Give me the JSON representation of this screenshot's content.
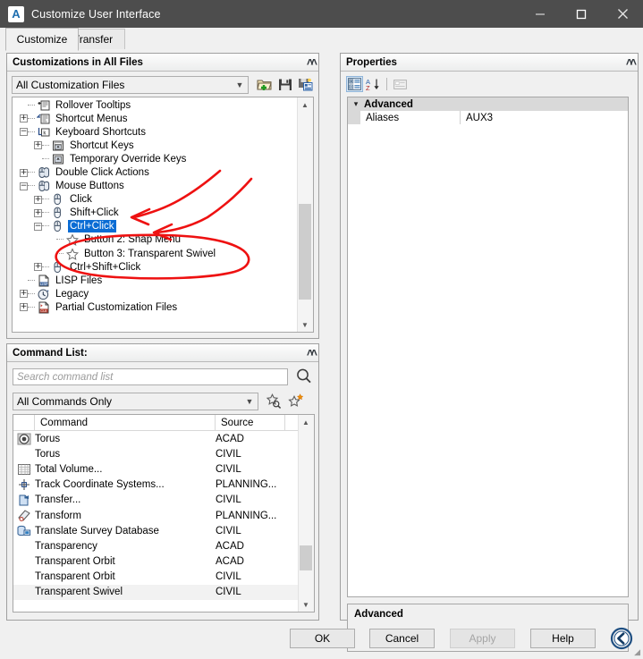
{
  "window": {
    "title": "Customize User Interface",
    "app_icon": "autocad-a-icon",
    "minimize": "minimize-icon",
    "maximize": "maximize-icon",
    "close": "close-icon"
  },
  "tabs": [
    {
      "label": "Customize",
      "active": true
    },
    {
      "label": "Transfer",
      "active": false
    }
  ],
  "customizations_panel": {
    "title": "Customizations in All Files",
    "collapse_icon": "chevron-up-icon",
    "file_filter": {
      "value": "All Customization Files",
      "arrow": "chevron-down-icon"
    },
    "toolbar": [
      {
        "name": "load-partial-customization-file-icon"
      },
      {
        "name": "save-customization-file-icon"
      },
      {
        "name": "save-all-customization-files-icon"
      }
    ],
    "tree": [
      {
        "label": "Rollover Tooltips",
        "indent": 1,
        "expander": "none",
        "icon": "rollover-tooltip-icon",
        "selected": false
      },
      {
        "label": "Shortcut Menus",
        "indent": 1,
        "expander": "plus",
        "icon": "shortcut-menu-icon",
        "selected": false
      },
      {
        "label": "Keyboard Shortcuts",
        "indent": 1,
        "expander": "minus",
        "icon": "keyboard-shortcut-icon",
        "selected": false
      },
      {
        "label": "Shortcut Keys",
        "indent": 2,
        "expander": "plus",
        "icon": "shortcut-key-icon",
        "selected": false
      },
      {
        "label": "Temporary Override Keys",
        "indent": 2,
        "expander": "none",
        "icon": "override-key-icon",
        "selected": false
      },
      {
        "label": "Double Click Actions",
        "indent": 1,
        "expander": "plus",
        "icon": "double-click-mouse-icon",
        "selected": false
      },
      {
        "label": "Mouse Buttons",
        "indent": 1,
        "expander": "minus",
        "icon": "mouse-buttons-icon",
        "selected": false
      },
      {
        "label": "Click",
        "indent": 2,
        "expander": "plus",
        "icon": "mouse-icon",
        "selected": false
      },
      {
        "label": "Shift+Click",
        "indent": 2,
        "expander": "plus",
        "icon": "mouse-icon",
        "selected": false
      },
      {
        "label": "Ctrl+Click",
        "indent": 2,
        "expander": "minus",
        "icon": "mouse-icon",
        "selected": true
      },
      {
        "label": "Button 2: Snap Menu",
        "indent": 3,
        "expander": "none",
        "icon": "star-command-icon",
        "selected": false
      },
      {
        "label": "Button 3: Transparent Swivel",
        "indent": 3,
        "expander": "none",
        "icon": "star-command-icon",
        "selected": false
      },
      {
        "label": "Ctrl+Shift+Click",
        "indent": 2,
        "expander": "plus",
        "icon": "mouse-icon",
        "selected": false
      },
      {
        "label": "LISP Files",
        "indent": 1,
        "expander": "none",
        "icon": "lisp-file-icon",
        "selected": false
      },
      {
        "label": "Legacy",
        "indent": 1,
        "expander": "plus",
        "icon": "legacy-clock-icon",
        "selected": false
      },
      {
        "label": "Partial Customization Files",
        "indent": 1,
        "expander": "plus",
        "icon": "cui-file-icon",
        "selected": false
      }
    ],
    "scroll": {
      "up_arrow": "chevron-up-icon",
      "down_arrow": "chevron-down-icon"
    }
  },
  "command_list_panel": {
    "title": "Command List:",
    "collapse_icon": "chevron-up-icon",
    "search": {
      "placeholder": "Search command list",
      "value": "",
      "icon": "search-icon"
    },
    "category_filter": {
      "value": "All Commands Only",
      "arrow": "chevron-down-icon"
    },
    "toolbar": [
      {
        "name": "find-command-icon"
      },
      {
        "name": "new-command-icon"
      }
    ],
    "columns": [
      "",
      "Command",
      "Source"
    ],
    "rows": [
      {
        "icon": "torus-icon",
        "command": "Torus",
        "source": "ACAD",
        "highlighted": false
      },
      {
        "icon": "none",
        "command": "Torus",
        "source": "CIVIL",
        "highlighted": false
      },
      {
        "icon": "total-volume-icon",
        "command": "Total Volume...",
        "source": "CIVIL",
        "highlighted": false
      },
      {
        "icon": "track-coordinate-icon",
        "command": "Track Coordinate Systems...",
        "source": "PLANNING...",
        "highlighted": false
      },
      {
        "icon": "transfer-icon",
        "command": "Transfer...",
        "source": "CIVIL",
        "highlighted": false
      },
      {
        "icon": "transform-icon",
        "command": "Transform",
        "source": "PLANNING...",
        "highlighted": false
      },
      {
        "icon": "translate-survey-icon",
        "command": "Translate Survey Database",
        "source": "CIVIL",
        "highlighted": false
      },
      {
        "icon": "none",
        "command": "Transparency",
        "source": "ACAD",
        "highlighted": false
      },
      {
        "icon": "none",
        "command": "Transparent Orbit",
        "source": "ACAD",
        "highlighted": false
      },
      {
        "icon": "none",
        "command": "Transparent Orbit",
        "source": "CIVIL",
        "highlighted": false
      },
      {
        "icon": "none",
        "command": "Transparent Swivel",
        "source": "CIVIL",
        "highlighted": true
      }
    ],
    "scroll": {
      "up_arrow": "chevron-up-icon",
      "down_arrow": "chevron-down-icon"
    }
  },
  "properties_panel": {
    "title": "Properties",
    "collapse_icon": "chevron-up-icon",
    "toolbar": [
      {
        "name": "categorized-view-icon",
        "active": true
      },
      {
        "name": "alphabetical-sort-icon",
        "active": false
      },
      {
        "name": "property-description-toggle-icon",
        "active": false
      }
    ],
    "categories": [
      {
        "name": "Advanced",
        "twisty": "chevron-down-icon",
        "properties": [
          {
            "name": "Aliases",
            "value": "AUX3"
          }
        ]
      }
    ],
    "description": {
      "title": "Advanced",
      "text": ""
    }
  },
  "footer": {
    "buttons": [
      {
        "label": "OK",
        "enabled": true
      },
      {
        "label": "Cancel",
        "enabled": true
      },
      {
        "label": "Apply",
        "enabled": false
      },
      {
        "label": "Help",
        "enabled": true
      }
    ],
    "expand_toggle": {
      "name": "collapse-pane-arrow-icon",
      "direction": "left"
    }
  },
  "annotations": {
    "ink_color": "#ee1111",
    "marks": [
      "arrow-to-shift-click",
      "arrow-to-ctrl-click",
      "ellipse-around-button-2-and-3"
    ]
  }
}
